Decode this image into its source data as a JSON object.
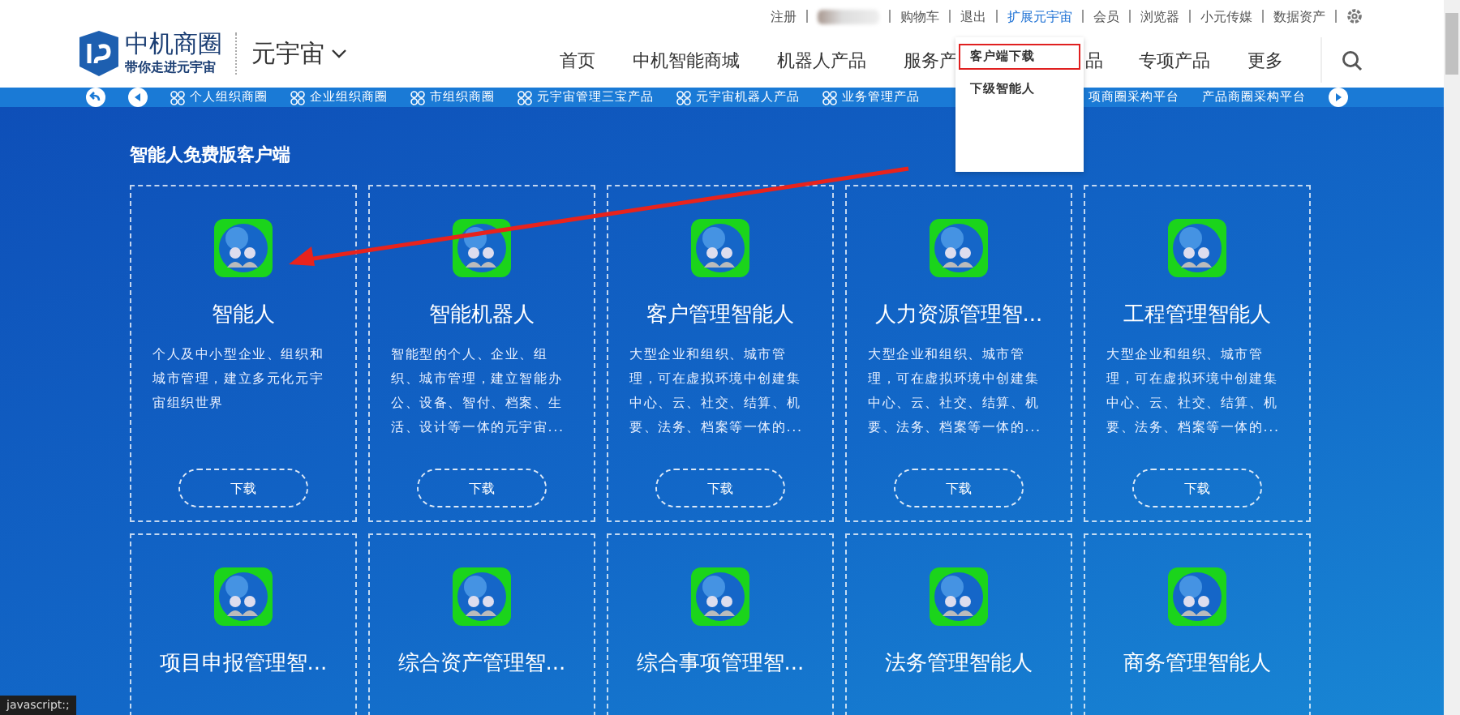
{
  "logo": {
    "name": "中机商圈",
    "slogan": "带你走进元宇宙",
    "section": "元宇宙"
  },
  "top_links": [
    {
      "label": "注册",
      "kind": "link",
      "selected": false
    },
    {
      "kind": "redacted"
    },
    {
      "label": "购物车",
      "kind": "link",
      "selected": false
    },
    {
      "label": "退出",
      "kind": "link",
      "selected": false
    },
    {
      "label": "扩展元宇宙",
      "kind": "link",
      "selected": true
    },
    {
      "label": "会员",
      "kind": "link",
      "selected": false
    },
    {
      "label": "浏览器",
      "kind": "link",
      "selected": false
    },
    {
      "label": "小元传媒",
      "kind": "link",
      "selected": false
    },
    {
      "label": "数据资产",
      "kind": "link",
      "selected": false
    }
  ],
  "nav": [
    {
      "label": "首页",
      "kind": "full"
    },
    {
      "label": "中机智能商城",
      "kind": "full"
    },
    {
      "label": "机器人产品",
      "kind": "full"
    },
    {
      "label": "服务产",
      "kind": "full"
    },
    {
      "label": "品",
      "kind": "partial"
    },
    {
      "label": "专项产品",
      "kind": "full"
    },
    {
      "label": "更多",
      "kind": "full"
    }
  ],
  "dropdown": [
    {
      "label": "客户端下载",
      "selected": true
    },
    {
      "label": "下级智能人",
      "selected": false
    }
  ],
  "sub_nav": [
    {
      "label": "个人组织商圈",
      "kind": "grid"
    },
    {
      "label": "企业组织商圈",
      "kind": "grid"
    },
    {
      "label": "市组织商圈",
      "kind": "grid"
    },
    {
      "label": "元宇宙管理三宝产品",
      "kind": "grid"
    },
    {
      "label": "元宇宙机器人产品",
      "kind": "grid"
    },
    {
      "label": "业务管理产品",
      "kind": "grid"
    },
    {
      "label": "项商圈采构平台",
      "kind": "plain"
    },
    {
      "label": "产品商圈采构平台",
      "kind": "plain"
    }
  ],
  "section_title": "智能人免费版客户端",
  "cards": [
    {
      "title": "智能人",
      "description": "个人及中小型企业、组织和城市管理，建立多元化元宇宙组织世界",
      "button": "下载"
    },
    {
      "title": "智能机器人",
      "description": "智能型的个人、企业、组织、城市管理，建立智能办公、设备、智付、档案、生活、设计等一体的元宇宙...",
      "button": "下载"
    },
    {
      "title": "客户管理智能人",
      "description": "大型企业和组织、城市管理，可在虚拟环境中创建集中心、云、社交、结算、机要、法务、档案等一体的...",
      "button": "下载"
    },
    {
      "title": "人力资源管理智...",
      "description": "大型企业和组织、城市管理，可在虚拟环境中创建集中心、云、社交、结算、机要、法务、档案等一体的...",
      "button": "下载"
    },
    {
      "title": "工程管理智能人",
      "description": "大型企业和组织、城市管理，可在虚拟环境中创建集中心、云、社交、结算、机要、法务、档案等一体的...",
      "button": "下载"
    },
    {
      "title": "项目申报管理智..."
    },
    {
      "title": "综合资产管理智..."
    },
    {
      "title": "综合事项管理智..."
    },
    {
      "title": "法务管理智能人"
    },
    {
      "title": "商务管理智能人"
    }
  ],
  "status_bar": "javascript:;"
}
